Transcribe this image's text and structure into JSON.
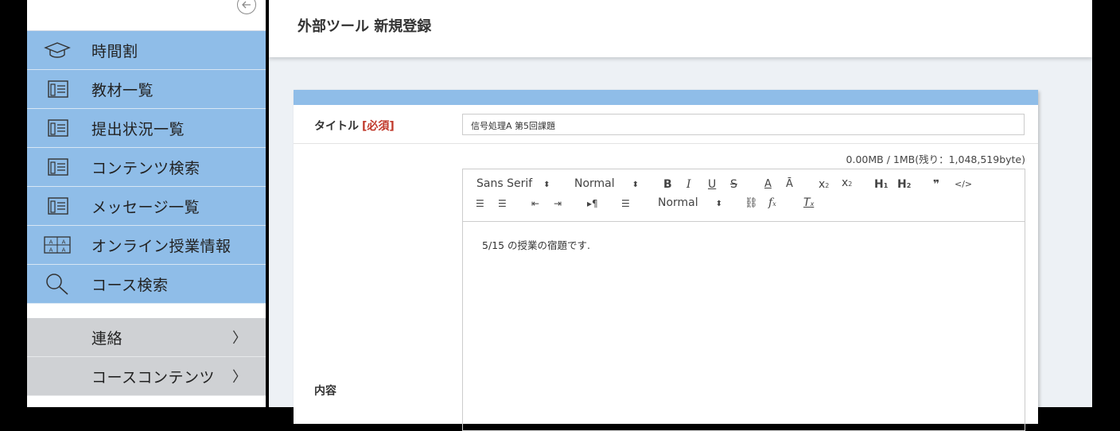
{
  "sidebar": {
    "nav": [
      {
        "label": "時間割",
        "icon": "graduation-cap-icon"
      },
      {
        "label": "教材一覧",
        "icon": "document-list-icon"
      },
      {
        "label": "提出状況一覧",
        "icon": "document-list-icon"
      },
      {
        "label": "コンテンツ検索",
        "icon": "document-list-icon"
      },
      {
        "label": "メッセージ一覧",
        "icon": "document-list-icon"
      },
      {
        "label": "オンライン授業情報",
        "icon": "online-class-icon"
      },
      {
        "label": "コース検索",
        "icon": "search-icon"
      }
    ],
    "sections": [
      {
        "label": "連絡",
        "chevron": "〉"
      },
      {
        "label": "コースコンテンツ",
        "chevron": "〉"
      }
    ]
  },
  "header": {
    "title": "外部ツール 新規登録"
  },
  "form": {
    "title_label": "タイトル",
    "required_label": "[必須]",
    "title_value": "信号処理A 第5回課題",
    "size_info": "0.00MB / 1MB(残り：1,048,519byte)",
    "content_label": "内容",
    "editor": {
      "font_select": "Sans Serif",
      "size_select": "Normal",
      "header_select": "Normal",
      "content": "5/15 の授業の宿題です."
    }
  },
  "colors": {
    "nav_blue": "#8fbde8",
    "gray": "#cfd1d4",
    "required": "#c0392b"
  }
}
